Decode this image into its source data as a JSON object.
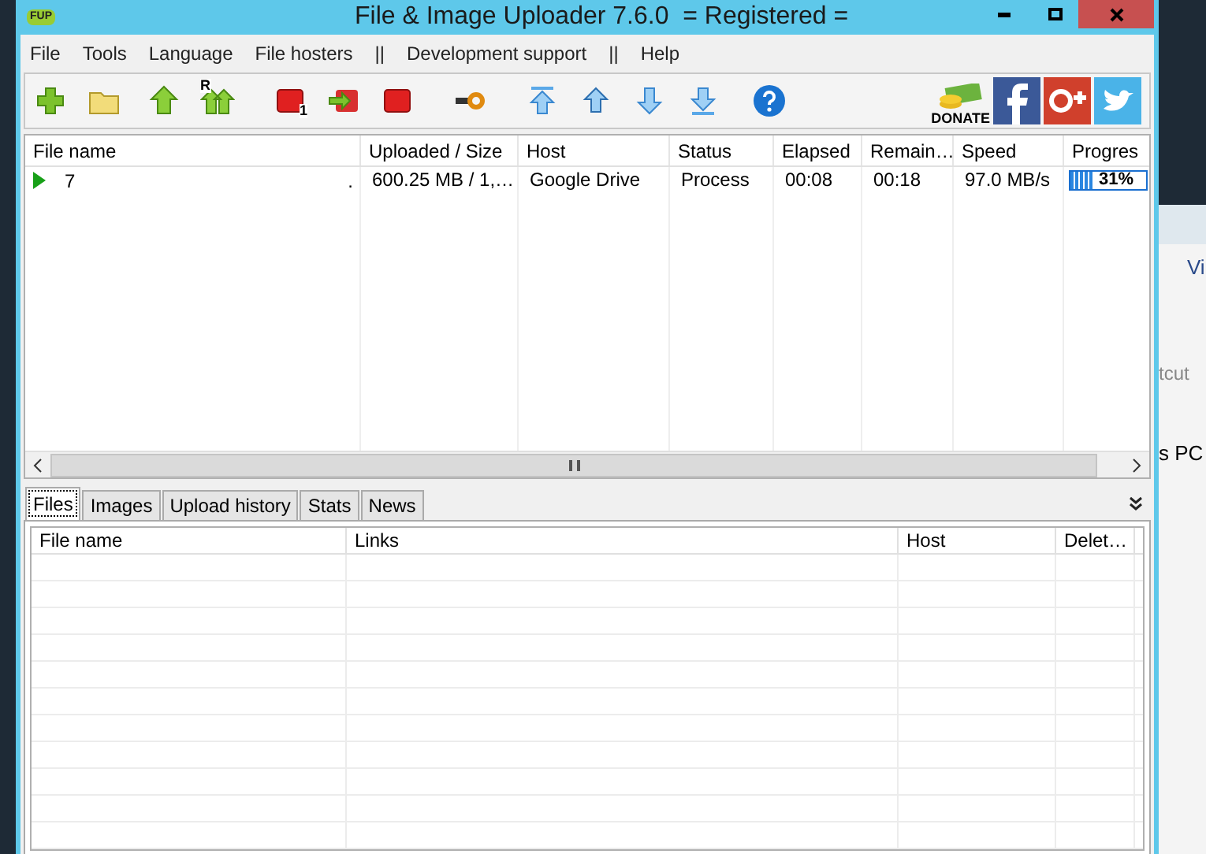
{
  "window": {
    "logo": "FUP",
    "title": "File & Image Uploader 7.6.0  = Registered ="
  },
  "menu": [
    "File",
    "Tools",
    "Language",
    "File hosters",
    "||",
    "Development support",
    "||",
    "Help"
  ],
  "toolbar": [
    {
      "kind": "add"
    },
    {
      "kind": "folder"
    },
    {
      "kind": "upload"
    },
    {
      "kind": "upload-r",
      "badge": "R"
    },
    {
      "kind": "stop-one",
      "badge": "1"
    },
    {
      "kind": "exit"
    },
    {
      "kind": "stop"
    },
    {
      "kind": "key"
    },
    {
      "kind": "top"
    },
    {
      "kind": "up"
    },
    {
      "kind": "down"
    },
    {
      "kind": "bottom"
    },
    {
      "kind": "help"
    }
  ],
  "social": {
    "donate": "DONATE"
  },
  "uploads": {
    "columns": [
      "File name",
      "Uploaded / Size",
      "Host",
      "Status",
      "Elapsed",
      "Remain…",
      "Speed",
      "Progres"
    ],
    "rows": [
      {
        "name": "7",
        "dot": ".",
        "uploaded": "600.25 MB / 1,…",
        "host": "Google Drive",
        "status": "Process",
        "elapsed": "00:08",
        "remaining": "00:18",
        "speed": "97.0 MB/s",
        "level": 0.31,
        "percent": "31%"
      }
    ]
  },
  "tabs": [
    {
      "label": "Files",
      "selected": true
    },
    {
      "label": "Images",
      "selected": false
    },
    {
      "label": "Upload history",
      "selected": false
    },
    {
      "label": "Stats",
      "selected": false
    },
    {
      "label": "News",
      "selected": false
    }
  ],
  "files": {
    "columns": [
      "File name",
      "Links",
      "Host",
      "Delet…"
    ]
  },
  "background_window": {
    "texts": [
      "Vi",
      "tcut",
      "s PC"
    ]
  }
}
